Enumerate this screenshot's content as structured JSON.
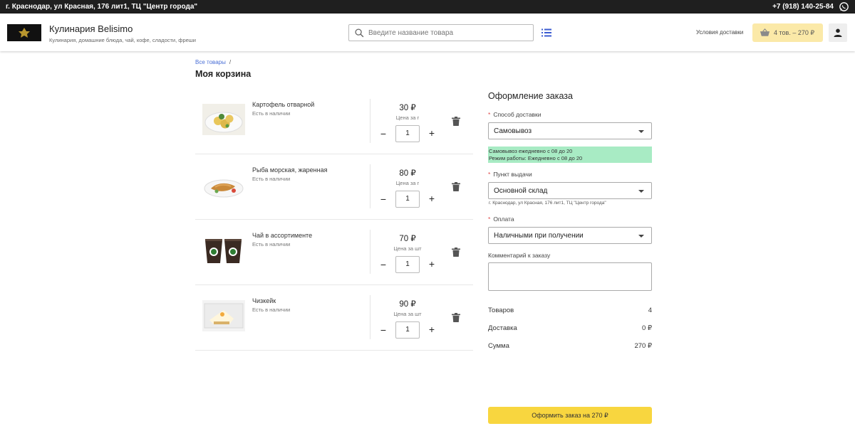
{
  "topbar": {
    "address": "г. Краснодар, ул Красная, 176 лит1, ТЦ \"Центр города\"",
    "phone": "+7 (918) 140-25-84",
    "whatsapp_icon": "whatsapp-icon"
  },
  "header": {
    "logo_icon": "belisimo-logo",
    "title": "Кулинария Belisimo",
    "subtitle": "Кулинария, домашние блюда, чай, кофе, сладости, фреши",
    "search_placeholder": "Введите название товара",
    "delivery_link": "Условия доставки",
    "cart_label": "4 тов. – 270 ₽"
  },
  "breadcrumb": {
    "all_goods": "Все товары",
    "separator": "/"
  },
  "page_title": "Моя корзина",
  "cart": {
    "items": [
      {
        "name": "Картофель отварной",
        "stock": "Есть в наличии",
        "price": "30 ₽",
        "unit": "Цена за г",
        "qty": "1",
        "minus": "−",
        "plus": "+"
      },
      {
        "name": "Рыба морская, жаренная",
        "stock": "Есть в наличии",
        "price": "80 ₽",
        "unit": "Цена за г",
        "qty": "1",
        "minus": "−",
        "plus": "+"
      },
      {
        "name": "Чай в ассортименте",
        "stock": "Есть в наличии",
        "price": "70 ₽",
        "unit": "Цена за шт",
        "qty": "1",
        "minus": "−",
        "plus": "+"
      },
      {
        "name": "Чизкейк",
        "stock": "Есть в наличии",
        "price": "90 ₽",
        "unit": "Цена за шт",
        "qty": "1",
        "minus": "−",
        "plus": "+"
      }
    ]
  },
  "order": {
    "title": "Оформление заказа",
    "required_mark": "*",
    "delivery_label": "Способ доставки",
    "delivery_value": "Самовывоз",
    "delivery_info_1": "Самовывоз ежедневно с 08 до 20",
    "delivery_info_2": "Режим работы: Ежедневно с 08 до 20",
    "pickup_label": "Пункт выдачи",
    "pickup_value": "Основной склад",
    "pickup_address": "г. Краснодар, ул Красная, 176 лит1, ТЦ \"Центр города\"",
    "payment_label": "Оплата",
    "payment_value": "Наличными при получении",
    "comment_label": "Комментарий к заказу",
    "comment_value": "",
    "summary": {
      "goods_label": "Товаров",
      "goods_value": "4",
      "delivery_label": "Доставка",
      "delivery_value": "0 ₽",
      "total_label": "Сумма",
      "total_value": "270 ₽"
    },
    "submit_label": "Оформить заказ на 270 ₽"
  },
  "colors": {
    "topbar_bg": "#1f1f1f",
    "cart_button_bg": "#fbe9a8",
    "info_green": "#a8ebc4",
    "submit_bg": "#f8d63f",
    "link_blue": "#4a6fd6",
    "required_red": "#e04a4a"
  }
}
